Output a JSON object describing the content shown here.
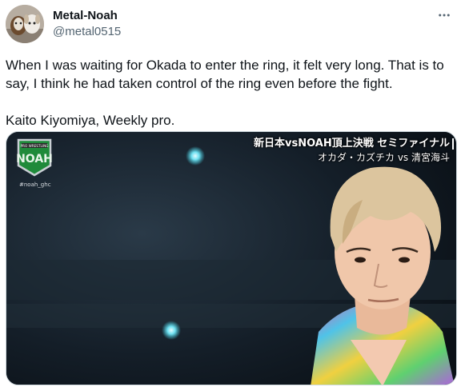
{
  "tweet": {
    "author": {
      "display_name": "Metal-Noah",
      "handle": "@metal0515",
      "avatar": "two-dogs-avatar"
    },
    "more_icon": "more-dots-icon",
    "text": "When I was waiting for Okada to enter the ring, it felt very long. That is to say, I think he had taken control of the ring even before the fight.\n\nKaito Kiyomiya, Weekly pro."
  },
  "media": {
    "logo_text": "NOAH",
    "logo_subtext": "PRO WRESTLING",
    "hashtag": "#noah_ghc",
    "caption_line1": "新日本vsNOAH頂上決戦 セミファイナル",
    "caption_line2": "オカダ・カズチカ vs 清宮海斗",
    "colors": {
      "logo_green": "#1f8a3a",
      "logo_border": "#c9cfd4",
      "background": "#101820",
      "hair": "#d9c39a"
    }
  }
}
